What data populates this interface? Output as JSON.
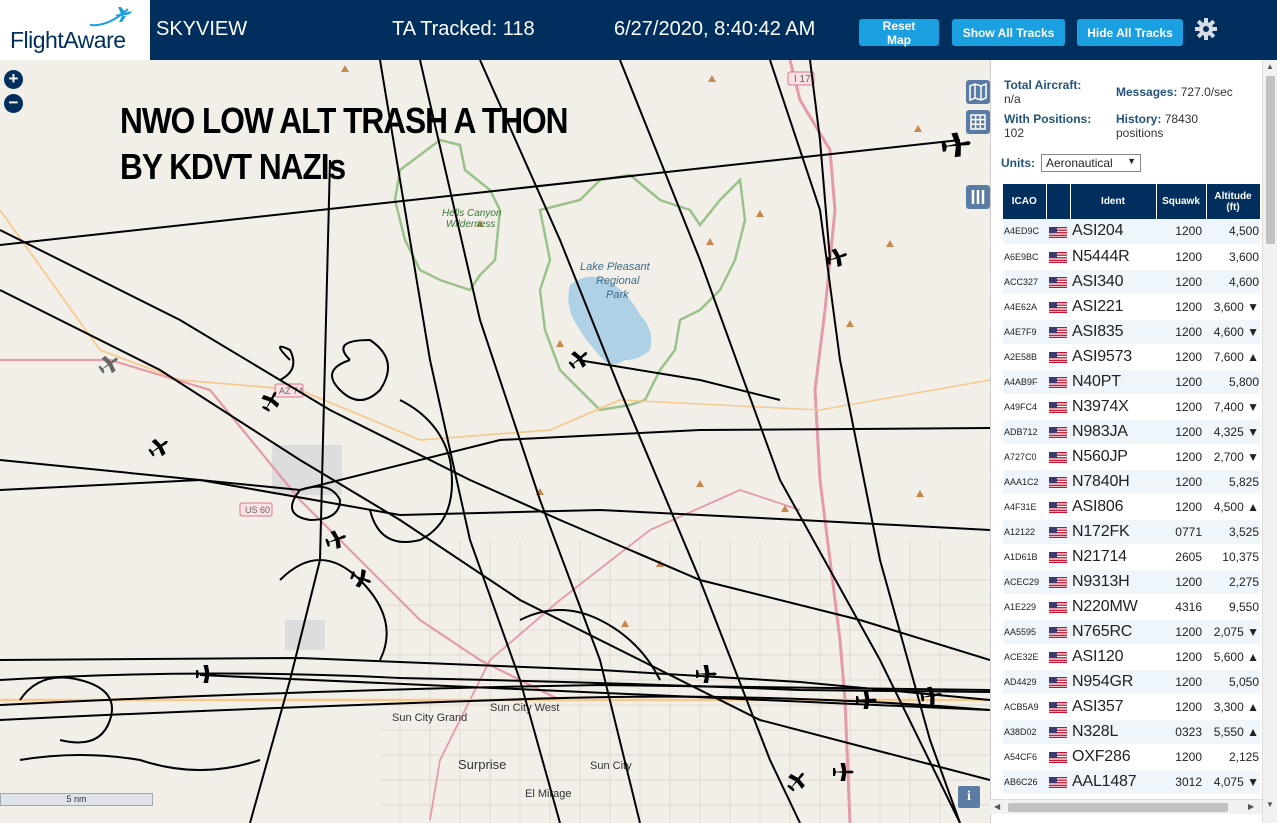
{
  "header": {
    "logo_text": "FlightAware",
    "app_name": "SKYVIEW",
    "tracked_label": "TA Tracked: 118",
    "datetime": "6/27/2020, 8:40:42 AM",
    "buttons": {
      "reset": "Reset Map",
      "show_all": "Show All Tracks",
      "hide_all": "Hide All Tracks"
    }
  },
  "map": {
    "overlay_line1": "NWO LOW ALT TRASH A THON",
    "overlay_line2": "BY KDVT NAZIs",
    "scale_label": "5 nm",
    "labels": {
      "hells_canyon": "Hells Canyon",
      "wilderness": "Wilderness",
      "lake1": "Lake Pleasant",
      "lake2": "Regional",
      "lake3": "Park",
      "sun_city_grand": "Sun City Grand",
      "sun_city_west": "Sun City West",
      "surprise": "Surprise",
      "sun_city": "Sun City",
      "el_mirage": "El Mirage",
      "i17": "I 17",
      "az74": "AZ 74",
      "us60": "US 60"
    }
  },
  "stats": {
    "total_label": "Total Aircraft:",
    "total_value": "n/a",
    "positions_label": "With Positions:",
    "positions_value": "102",
    "messages_label": "Messages:",
    "messages_value": "727.0/sec",
    "history_label": "History:",
    "history_value": "78430",
    "history_unit": "positions",
    "units_label": "Units:",
    "units_value": "Aeronautical"
  },
  "table": {
    "headers": {
      "icao": "ICAO",
      "ident": "Ident",
      "squawk": "Squawk",
      "altitude": "Altitude (ft)"
    },
    "rows": [
      {
        "icao": "A4ED9C",
        "ident": "ASI204",
        "squawk": "1200",
        "alt": "4,500"
      },
      {
        "icao": "A6E9BC",
        "ident": "N5444R",
        "squawk": "1200",
        "alt": "3,600"
      },
      {
        "icao": "ACC327",
        "ident": "ASI340",
        "squawk": "1200",
        "alt": "4,600"
      },
      {
        "icao": "A4E62A",
        "ident": "ASI221",
        "squawk": "1200",
        "alt": "3,600 ▼"
      },
      {
        "icao": "A4E7F9",
        "ident": "ASI835",
        "squawk": "1200",
        "alt": "4,600 ▼"
      },
      {
        "icao": "A2E58B",
        "ident": "ASI9573",
        "squawk": "1200",
        "alt": "7,600 ▲"
      },
      {
        "icao": "A4AB9F",
        "ident": "N40PT",
        "squawk": "1200",
        "alt": "5,800"
      },
      {
        "icao": "A49FC4",
        "ident": "N3974X",
        "squawk": "1200",
        "alt": "7,400 ▼"
      },
      {
        "icao": "ADB712",
        "ident": "N983JA",
        "squawk": "1200",
        "alt": "4,325 ▼"
      },
      {
        "icao": "A727C0",
        "ident": "N560JP",
        "squawk": "1200",
        "alt": "2,700 ▼"
      },
      {
        "icao": "AAA1C2",
        "ident": "N7840H",
        "squawk": "1200",
        "alt": "5,825"
      },
      {
        "icao": "A4F31E",
        "ident": "ASI806",
        "squawk": "1200",
        "alt": "4,500 ▲"
      },
      {
        "icao": "A12122",
        "ident": "N172FK",
        "squawk": "0771",
        "alt": "3,525"
      },
      {
        "icao": "A1D61B",
        "ident": "N21714",
        "squawk": "2605",
        "alt": "10,375"
      },
      {
        "icao": "ACEC29",
        "ident": "N9313H",
        "squawk": "1200",
        "alt": "2,275"
      },
      {
        "icao": "A1E229",
        "ident": "N220MW",
        "squawk": "4316",
        "alt": "9,550"
      },
      {
        "icao": "AA5595",
        "ident": "N765RC",
        "squawk": "1200",
        "alt": "2,075 ▼"
      },
      {
        "icao": "ACE32E",
        "ident": "ASI120",
        "squawk": "1200",
        "alt": "5,600 ▲"
      },
      {
        "icao": "AD4429",
        "ident": "N954GR",
        "squawk": "1200",
        "alt": "5,050"
      },
      {
        "icao": "ACB5A9",
        "ident": "ASI357",
        "squawk": "1200",
        "alt": "3,300 ▲"
      },
      {
        "icao": "A38D02",
        "ident": "N328L",
        "squawk": "0323",
        "alt": "5,550 ▲"
      },
      {
        "icao": "A54CF6",
        "ident": "OXF286",
        "squawk": "1200",
        "alt": "2,125"
      },
      {
        "icao": "AB6C26",
        "ident": "AAL1487",
        "squawk": "3012",
        "alt": "4,075 ▼"
      }
    ]
  },
  "colors": {
    "header_bg": "#002f5d",
    "button_bg": "#1a9fe0",
    "map_bg": "#f2efe9",
    "track": "#000000"
  }
}
